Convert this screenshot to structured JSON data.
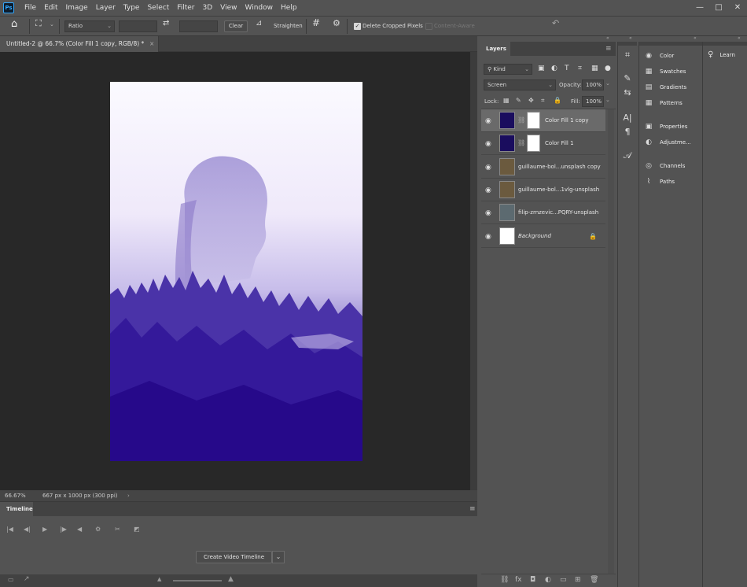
{
  "app": {
    "logo": "Ps"
  },
  "menu": [
    "File",
    "Edit",
    "Image",
    "Layer",
    "Type",
    "Select",
    "Filter",
    "3D",
    "View",
    "Window",
    "Help"
  ],
  "window_controls": {
    "minimize": "—",
    "maximize": "□",
    "close": "✕"
  },
  "options_bar": {
    "home_icon": "⌂",
    "crop_icon": "⛶",
    "ratio_label": "Ratio",
    "swap_icon": "⇄",
    "clear_label": "Clear",
    "straighten_label": "Straighten",
    "grid_icon": "#",
    "gear_icon": "⚙",
    "delete_cropped_label": "Delete Cropped Pixels",
    "delete_cropped_checked": true,
    "content_aware_label": "Content-Aware",
    "content_aware_checked": false,
    "reset_icon": "↶"
  },
  "document": {
    "tab_title": "Untitled-2 @ 66.7% (Color Fill 1 copy, RGB/8) *",
    "close_icon": "×",
    "image_colors": {
      "top": "#f4f0fb",
      "mid": "#a99ad8",
      "bottom": "#29108f"
    }
  },
  "status": {
    "zoom": "66.67%",
    "dimensions": "667 px x 1000 px (300 ppi)",
    "arrow": "›"
  },
  "timeline": {
    "tab": "Timeline",
    "menu_icon": "≡",
    "controls": [
      "|◀",
      "◀|",
      "▶",
      "|▶",
      "◀",
      "⚙",
      "✂",
      "◩"
    ],
    "create_button": "Create Video Timeline",
    "dropdown_icon": "⌄"
  },
  "layers_panel": {
    "tab": "Layers",
    "menu_icon": "≡",
    "filter_label": "Kind",
    "filter_icons": [
      "▣",
      "◐",
      "T",
      "⌗",
      "▦",
      "●"
    ],
    "blend_mode": "Screen",
    "opacity_label": "Opacity:",
    "opacity_value": "100%",
    "lock_label": "Lock:",
    "lock_icons": [
      "▦",
      "✎",
      "✥",
      "⌗",
      "🔒"
    ],
    "fill_label": "Fill:",
    "fill_value": "100%",
    "layers": [
      {
        "name": "Color Fill 1 copy",
        "selected": true,
        "has_mask": true,
        "thumb": "#1a0d5e",
        "italic": false
      },
      {
        "name": "Color Fill 1",
        "selected": false,
        "has_mask": true,
        "thumb": "#1a0d5e",
        "italic": false
      },
      {
        "name": "guillaume-bol...unsplash copy",
        "selected": false,
        "has_mask": false,
        "thumb": "#6b5a3e",
        "italic": false
      },
      {
        "name": "guillaume-bol...1vlg-unsplash",
        "selected": false,
        "has_mask": false,
        "thumb": "#6b5a3e",
        "italic": false
      },
      {
        "name": "filip-zrnzevic...PQRY-unsplash",
        "selected": false,
        "has_mask": false,
        "thumb": "#5c6a70",
        "italic": false
      },
      {
        "name": "Background",
        "selected": false,
        "has_mask": false,
        "thumb": "#ffffff",
        "italic": true,
        "locked": true
      }
    ],
    "footer_icons": [
      "⛓",
      "fx",
      "◘",
      "◐",
      "▭",
      "⊞",
      "🗑"
    ]
  },
  "tool_icons": [
    "⌗",
    "✎",
    "⇆",
    "A|",
    "¶",
    "𝒜"
  ],
  "right_panel": {
    "items": [
      {
        "label": "Color",
        "icon": "◉"
      },
      {
        "label": "Swatches",
        "icon": "▦"
      },
      {
        "label": "Gradients",
        "icon": "▤"
      },
      {
        "label": "Patterns",
        "icon": "▦"
      },
      {
        "label": "Properties",
        "icon": "▣"
      },
      {
        "label": "Adjustme...",
        "icon": "◐"
      },
      {
        "label": "Channels",
        "icon": "◎"
      },
      {
        "label": "Paths",
        "icon": "⌇"
      }
    ]
  },
  "learn_panel": {
    "label": "Learn",
    "icon": "♀"
  }
}
